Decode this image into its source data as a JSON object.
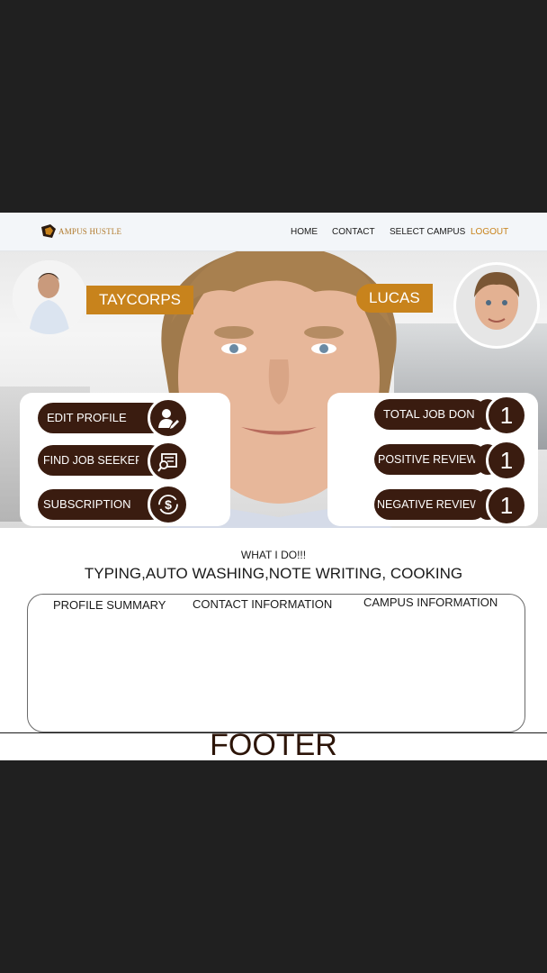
{
  "brand": {
    "logo_text": "AMPUS HUSTLE",
    "accent": "#c8831c",
    "dark": "#3a1c10"
  },
  "nav": {
    "home": "HOME",
    "contact": "CONTACT",
    "select_campus": "SELECT CAMPUS",
    "logout": "LOGOUT"
  },
  "profiles": {
    "left_name": "TAYCORPS",
    "right_name": "LUCAS"
  },
  "left_menu": [
    {
      "label": "EDIT PROFILE",
      "icon": "user-edit-icon"
    },
    {
      "label": "FIND JOB SEEKERS",
      "icon": "search-document-icon"
    },
    {
      "label": "SUBSCRIPTION",
      "icon": "dollar-refresh-icon"
    }
  ],
  "stats": [
    {
      "label": "TOTAL JOB DONE",
      "value": "1"
    },
    {
      "label": "POSITIVE REVIEWS",
      "value": "1"
    },
    {
      "label": "NEGATIVE REVIEWS",
      "value": "1"
    }
  ],
  "about": {
    "title": "WHAT I DO!!!",
    "skills": "TYPING,AUTO WASHING,NOTE WRITING, COOKING"
  },
  "info_tabs": [
    "PROFILE SUMMARY",
    "CONTACT INFORMATION",
    "CAMPUS INFORMATION"
  ],
  "footer": {
    "text": "FOOTER"
  }
}
